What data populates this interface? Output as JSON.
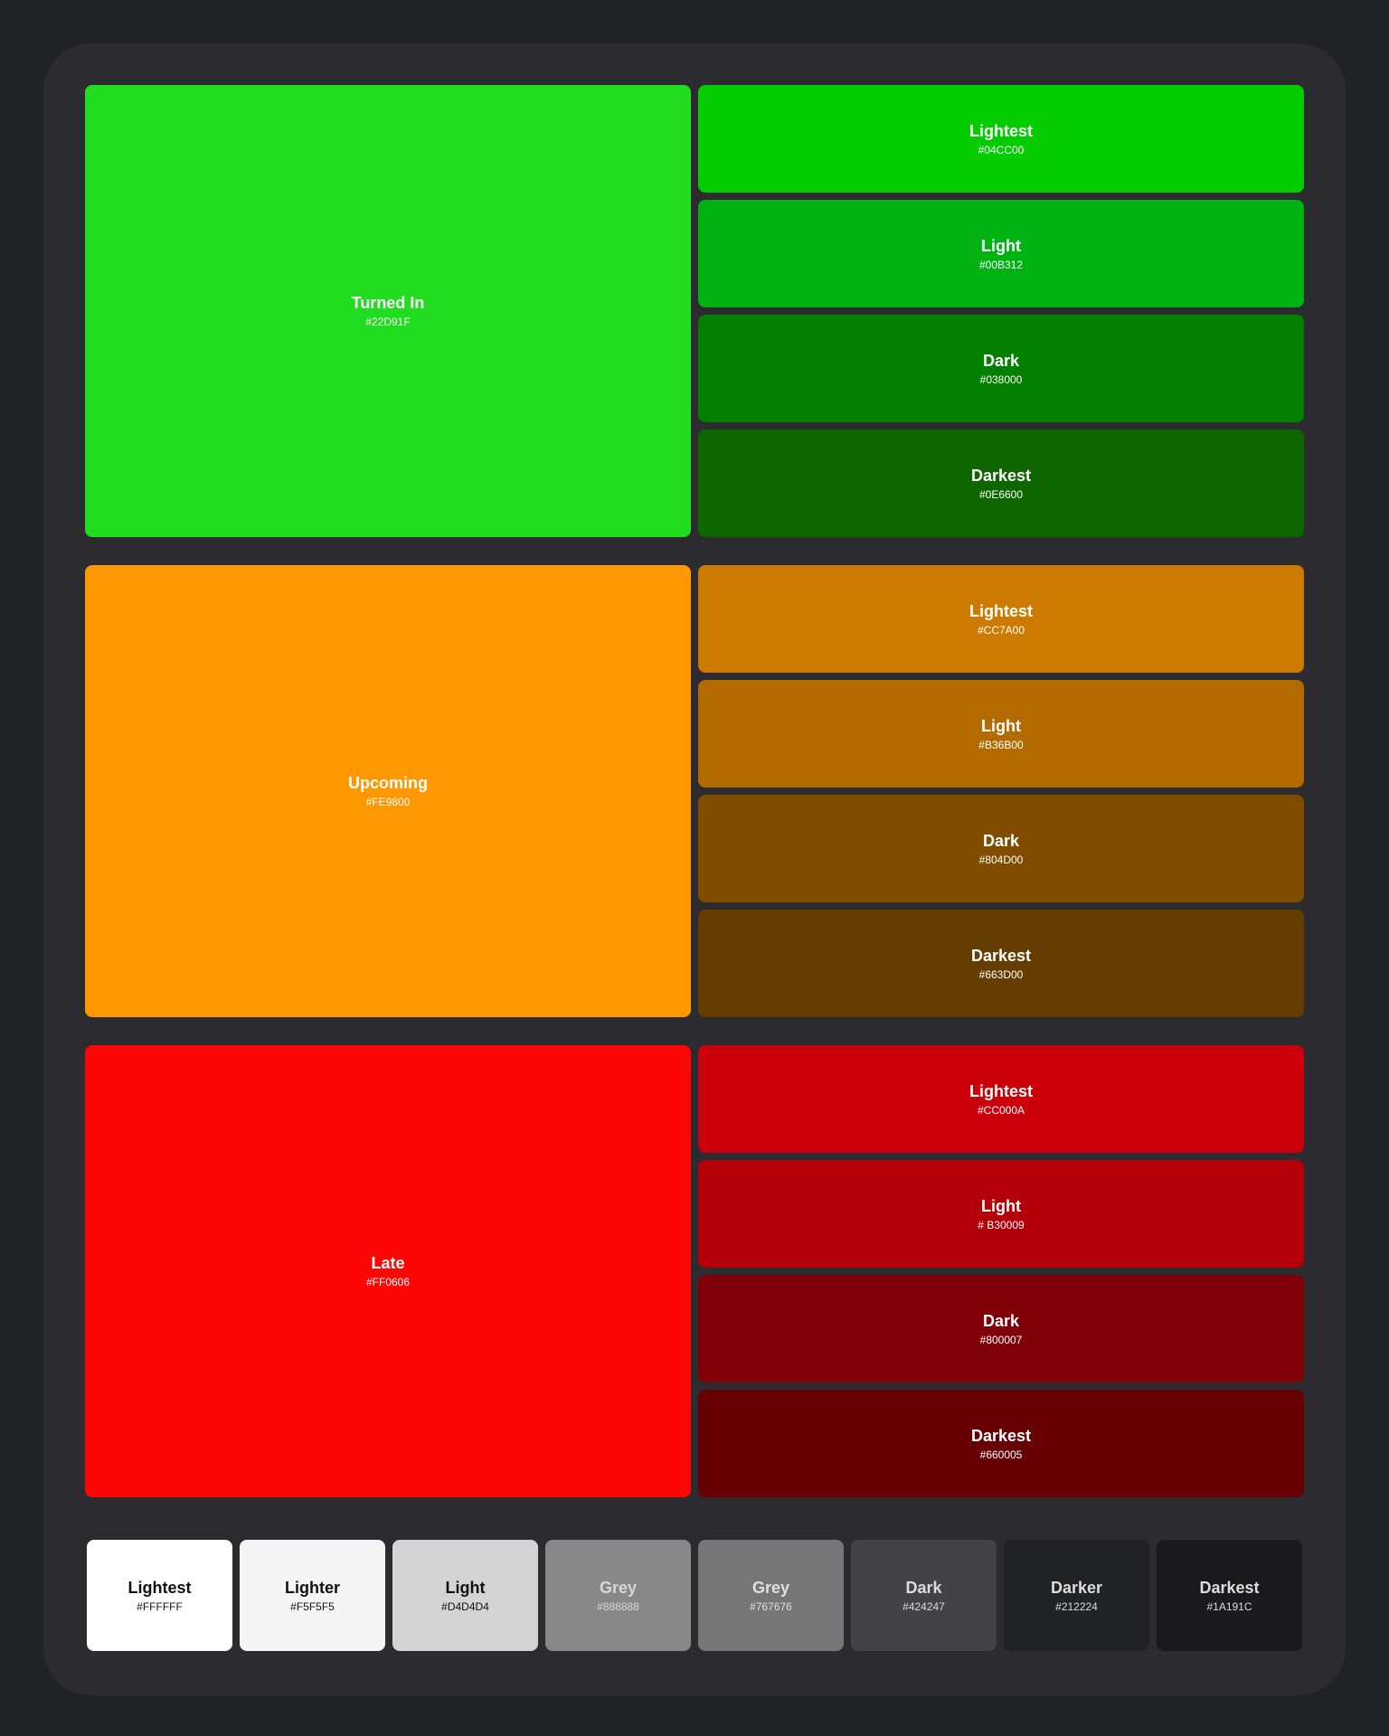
{
  "groups": [
    {
      "name": "Turned In",
      "hex": "#22D91F",
      "color": "#22DD1F",
      "shades": [
        {
          "label": "Lightest",
          "hex": "#04CC00",
          "color": "#04CC00"
        },
        {
          "label": "Light",
          "hex": "#00B312",
          "color": "#00B312"
        },
        {
          "label": "Dark",
          "hex": "#038000",
          "color": "#038000"
        },
        {
          "label": "Darkest",
          "hex": "#0E6600",
          "color": "#0E6600"
        }
      ]
    },
    {
      "name": "Upcoming",
      "hex": "#FE9800",
      "color": "#FE9800",
      "shades": [
        {
          "label": "Lightest",
          "hex": "#CC7A00",
          "color": "#CC7A00"
        },
        {
          "label": "Light",
          "hex": "#B36B00",
          "color": "#B36B00"
        },
        {
          "label": "Dark",
          "hex": "#804D00",
          "color": "#804D00"
        },
        {
          "label": "Darkest",
          "hex": "#663D00",
          "color": "#663D00"
        }
      ]
    },
    {
      "name": "Late",
      "hex": "#FF0606",
      "color": "#FF0606",
      "shades": [
        {
          "label": "Lightest",
          "hex": "#CC000A",
          "color": "#CC000A"
        },
        {
          "label": "Light",
          "hex": "# B30009",
          "color": "#B30009"
        },
        {
          "label": "Dark",
          "hex": "#800007",
          "color": "#800007"
        },
        {
          "label": "Darkest",
          "hex": "#660005",
          "color": "#660005"
        }
      ]
    }
  ],
  "greys": [
    {
      "label": "Lightest",
      "hex": "#FFFFFF",
      "color": "#FFFFFF",
      "text_color": "#111111"
    },
    {
      "label": "Lighter",
      "hex": "#F5F5F5",
      "color": "#F5F5F5",
      "text_color": "#111111"
    },
    {
      "label": "Light",
      "hex": "#D4D4D4",
      "color": "#D4D4D4",
      "text_color": "#111111"
    },
    {
      "label": "Grey",
      "hex": "#888888",
      "color": "#888888",
      "text_color": "#D8D8D8"
    },
    {
      "label": "Grey",
      "hex": "#767676",
      "color": "#767676",
      "text_color": "#E0E0E0"
    },
    {
      "label": "Dark",
      "hex": "#424247",
      "color": "#424247",
      "text_color": "#DDDDDD"
    },
    {
      "label": "Darker",
      "hex": "#212224",
      "color": "#212224",
      "text_color": "#DDDDDD"
    },
    {
      "label": "Darkest",
      "hex": "#1A191C",
      "color": "#1A191C",
      "text_color": "#DDDDDD"
    }
  ]
}
